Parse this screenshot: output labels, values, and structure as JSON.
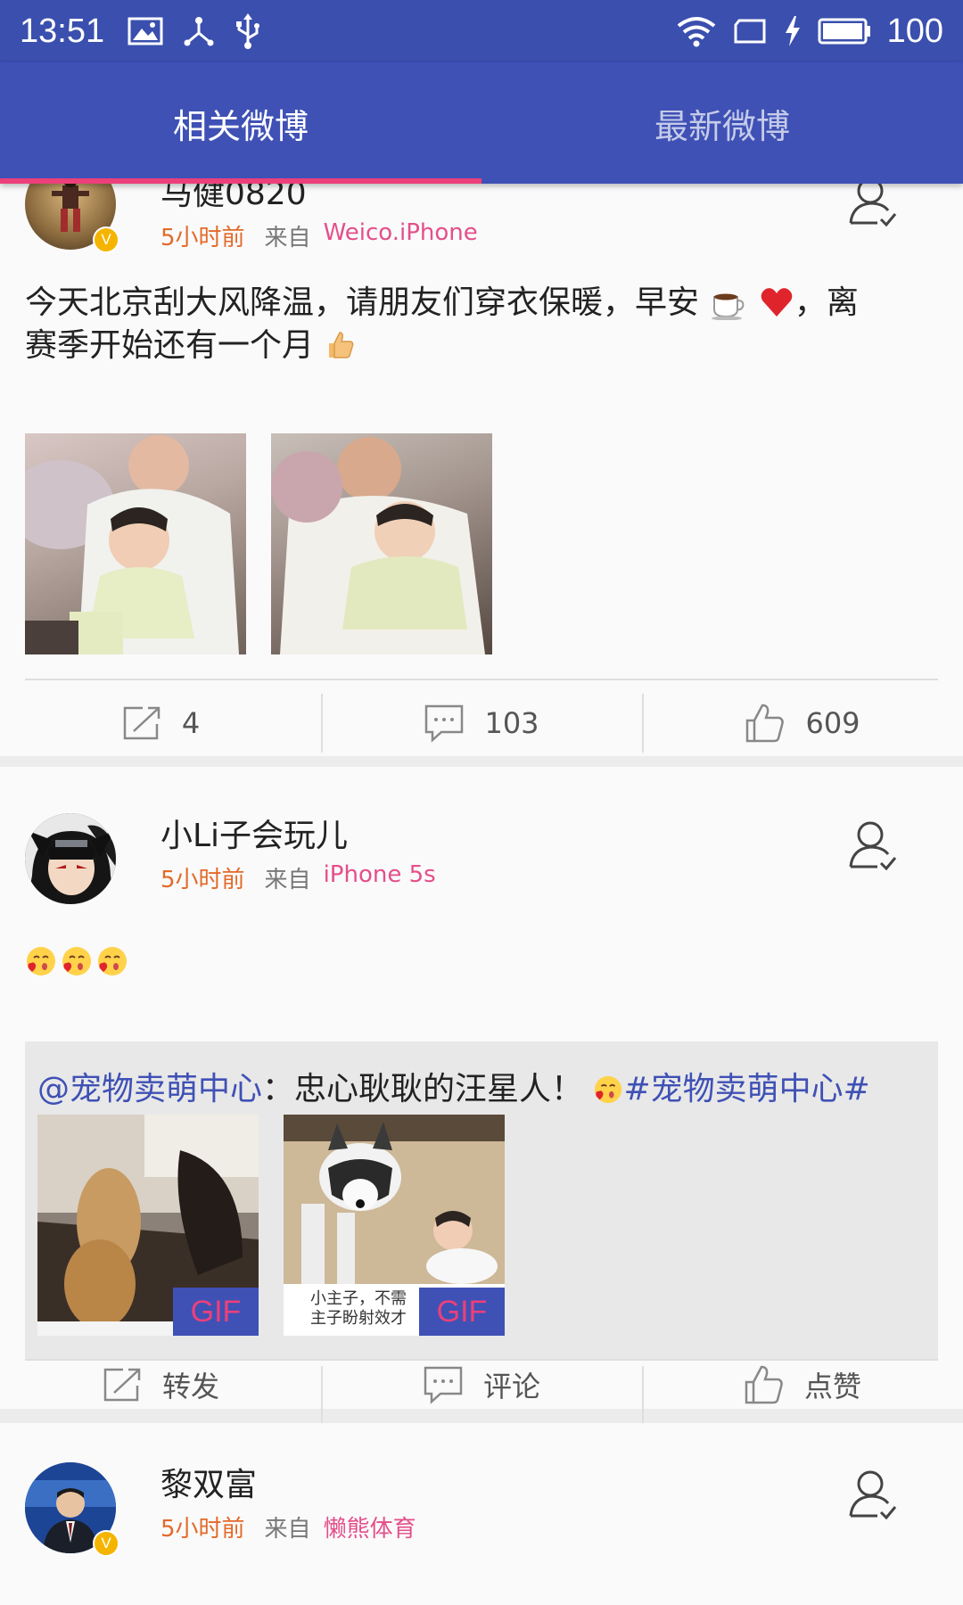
{
  "status_bar": {
    "time": "13:51",
    "battery": "100",
    "icons": [
      "image-icon",
      "usb-tether-icon",
      "usb-icon",
      "wifi-icon",
      "tablet-icon",
      "charging-icon",
      "battery-icon"
    ]
  },
  "tabs": [
    {
      "label": "相关微博",
      "active": true
    },
    {
      "label": "最新微博",
      "active": false
    }
  ],
  "posts": [
    {
      "user": "马健0820",
      "verified": true,
      "time": "5小时前",
      "from_label": "来自",
      "source": "Weico.iPhone",
      "text": "今天北京刮大风降温，请朋友们穿衣保暖，早安☕❤️，离赛季开始还有一个月👍",
      "text_line1": "今天北京刮大风降温，请朋友们穿衣保暖，早安",
      "text_line1_tail": "，离",
      "text_line2": "赛季开始还有一个月",
      "actions": {
        "repost": "4",
        "comment": "103",
        "like": "609"
      }
    },
    {
      "user": "小Li子会玩儿",
      "verified": false,
      "time": "5小时前",
      "from_label": "来自",
      "source": "iPhone 5s",
      "repost": {
        "mention": "@宠物卖萌中心",
        "text": "：忠心耿耿的汪星人！",
        "hashtag": "#宠物卖萌中心#",
        "gif_label": "GIF",
        "image2_caption": "小主子，不需\n主子盼射效才"
      },
      "actions": {
        "repost": "转发",
        "comment": "评论",
        "like": "点赞"
      }
    },
    {
      "user": "黎双富",
      "verified": true,
      "time": "5小时前",
      "from_label": "来自",
      "source": "懒熊体育"
    }
  ],
  "colors": {
    "status_bar": "#3a4fae",
    "primary": "#3f51b5",
    "accent": "#ec407a",
    "time": "#e36a2a",
    "badge": "#f5b400"
  }
}
